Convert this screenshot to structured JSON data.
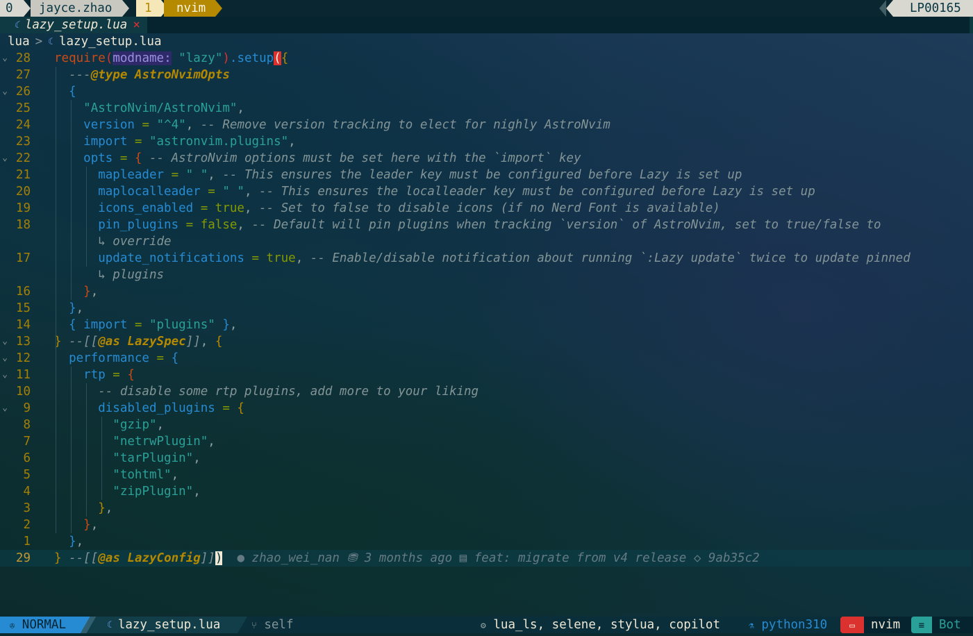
{
  "tmux": {
    "window_index": "0",
    "session": "jayce.zhao",
    "pane_index": "1",
    "program": "nvim",
    "host": "LP00165"
  },
  "tab": {
    "filename": "lazy_setup.lua",
    "close": "×"
  },
  "breadcrumb": {
    "dir": "lua",
    "separator": ">",
    "file": "lazy_setup.lua"
  },
  "lines": [
    {
      "num": "28",
      "fold": "v",
      "tokens": [
        [
          "kw",
          "require"
        ],
        [
          "br1",
          "("
        ],
        [
          "hint",
          "modname:"
        ],
        [
          "pun",
          " "
        ],
        [
          "str",
          "\"lazy\""
        ],
        [
          "br1",
          ")"
        ],
        [
          "fn",
          ".setup"
        ],
        [
          "match",
          "("
        ],
        [
          "br2",
          "{"
        ]
      ]
    },
    {
      "num": "27",
      "fold": "",
      "tokens": [
        [
          "cm",
          "  ---"
        ],
        [
          "an",
          "@type"
        ],
        [
          "pun",
          " "
        ],
        [
          "ty",
          "AstroNvimOpts"
        ]
      ]
    },
    {
      "num": "26",
      "fold": "v",
      "tokens": [
        [
          "pun",
          "  "
        ],
        [
          "br3",
          "{"
        ]
      ]
    },
    {
      "num": "25",
      "fold": "",
      "tokens": [
        [
          "pun",
          "    "
        ],
        [
          "str",
          "\"AstroNvim/AstroNvim\""
        ],
        [
          "pun",
          ","
        ]
      ]
    },
    {
      "num": "24",
      "fold": "",
      "tokens": [
        [
          "pun",
          "    "
        ],
        [
          "var",
          "version"
        ],
        [
          "op",
          " = "
        ],
        [
          "str",
          "\"^4\""
        ],
        [
          "pun",
          ", "
        ],
        [
          "cm",
          "-- Remove version tracking to elect for nighly AstroNvim"
        ]
      ]
    },
    {
      "num": "23",
      "fold": "",
      "tokens": [
        [
          "pun",
          "    "
        ],
        [
          "var",
          "import"
        ],
        [
          "op",
          " = "
        ],
        [
          "str",
          "\"astronvim.plugins\""
        ],
        [
          "pun",
          ","
        ]
      ]
    },
    {
      "num": "22",
      "fold": "v",
      "tokens": [
        [
          "pun",
          "    "
        ],
        [
          "var",
          "opts"
        ],
        [
          "op",
          " = "
        ],
        [
          "br5",
          "{"
        ],
        [
          "pun",
          " "
        ],
        [
          "cm",
          "-- AstroNvim options must be set here with the `import` key"
        ]
      ]
    },
    {
      "num": "21",
      "fold": "",
      "tokens": [
        [
          "pun",
          "      "
        ],
        [
          "var",
          "mapleader"
        ],
        [
          "op",
          " = "
        ],
        [
          "str",
          "\" \""
        ],
        [
          "pun",
          ", "
        ],
        [
          "cm",
          "-- This ensures the leader key must be configured before Lazy is set up"
        ]
      ]
    },
    {
      "num": "20",
      "fold": "",
      "tokens": [
        [
          "pun",
          "      "
        ],
        [
          "var",
          "maplocalleader"
        ],
        [
          "op",
          " = "
        ],
        [
          "str",
          "\" \""
        ],
        [
          "pun",
          ", "
        ],
        [
          "cm",
          "-- This ensures the localleader key must be configured before Lazy is set up"
        ]
      ]
    },
    {
      "num": "19",
      "fold": "",
      "tokens": [
        [
          "pun",
          "      "
        ],
        [
          "var",
          "icons_enabled"
        ],
        [
          "op",
          " = "
        ],
        [
          "bool",
          "true"
        ],
        [
          "pun",
          ", "
        ],
        [
          "cm",
          "-- Set to false to disable icons (if no Nerd Font is available)"
        ]
      ]
    },
    {
      "num": "18",
      "fold": "",
      "tokens": [
        [
          "pun",
          "      "
        ],
        [
          "var",
          "pin_plugins"
        ],
        [
          "op",
          " = "
        ],
        [
          "bool",
          "false"
        ],
        [
          "pun",
          ", "
        ],
        [
          "cm",
          "-- Default will pin plugins when tracking `version` of AstroNvim, set to true/false to"
        ]
      ]
    },
    {
      "num": "",
      "fold": "",
      "tokens": [
        [
          "pun",
          "      "
        ],
        [
          "wrapmark",
          "↳ "
        ],
        [
          "cm",
          "override"
        ]
      ]
    },
    {
      "num": "17",
      "fold": "",
      "tokens": [
        [
          "pun",
          "      "
        ],
        [
          "var",
          "update_notifications"
        ],
        [
          "op",
          " = "
        ],
        [
          "bool",
          "true"
        ],
        [
          "pun",
          ", "
        ],
        [
          "cm",
          "-- Enable/disable notification about running `:Lazy update` twice to update pinned"
        ]
      ]
    },
    {
      "num": "",
      "fold": "",
      "tokens": [
        [
          "pun",
          "      "
        ],
        [
          "wrapmark",
          "↳ "
        ],
        [
          "cm",
          "plugins"
        ]
      ]
    },
    {
      "num": "16",
      "fold": "",
      "tokens": [
        [
          "pun",
          "    "
        ],
        [
          "br5",
          "}"
        ],
        [
          "pun",
          ","
        ]
      ]
    },
    {
      "num": "15",
      "fold": "",
      "tokens": [
        [
          "pun",
          "  "
        ],
        [
          "br3",
          "}"
        ],
        [
          "pun",
          ","
        ]
      ]
    },
    {
      "num": "14",
      "fold": "",
      "tokens": [
        [
          "pun",
          "  "
        ],
        [
          "br3",
          "{"
        ],
        [
          "pun",
          " "
        ],
        [
          "var",
          "import"
        ],
        [
          "op",
          " = "
        ],
        [
          "str",
          "\"plugins\""
        ],
        [
          "pun",
          " "
        ],
        [
          "br3",
          "}"
        ],
        [
          "pun",
          ","
        ]
      ]
    },
    {
      "num": "13",
      "fold": "v",
      "tokens": [
        [
          "br2",
          "}"
        ],
        [
          "pun",
          " "
        ],
        [
          "cm",
          "--[["
        ],
        [
          "an",
          "@as"
        ],
        [
          "pun",
          " "
        ],
        [
          "ty",
          "LazySpec"
        ],
        [
          "cm",
          "]]"
        ],
        [
          "pun",
          ", "
        ],
        [
          "br2",
          "{"
        ]
      ]
    },
    {
      "num": "12",
      "fold": "v",
      "tokens": [
        [
          "pun",
          "  "
        ],
        [
          "var",
          "performance"
        ],
        [
          "op",
          " = "
        ],
        [
          "br3",
          "{"
        ]
      ]
    },
    {
      "num": "11",
      "fold": "v",
      "tokens": [
        [
          "pun",
          "    "
        ],
        [
          "var",
          "rtp"
        ],
        [
          "op",
          " = "
        ],
        [
          "br5",
          "{"
        ]
      ]
    },
    {
      "num": "10",
      "fold": "",
      "tokens": [
        [
          "pun",
          "      "
        ],
        [
          "cm",
          "-- disable some rtp plugins, add more to your liking"
        ]
      ]
    },
    {
      "num": "9",
      "fold": "v",
      "tokens": [
        [
          "pun",
          "      "
        ],
        [
          "var",
          "disabled_plugins"
        ],
        [
          "op",
          " = "
        ],
        [
          "br2",
          "{"
        ]
      ]
    },
    {
      "num": "8",
      "fold": "",
      "tokens": [
        [
          "pun",
          "        "
        ],
        [
          "str",
          "\"gzip\""
        ],
        [
          "pun",
          ","
        ]
      ]
    },
    {
      "num": "7",
      "fold": "",
      "tokens": [
        [
          "pun",
          "        "
        ],
        [
          "str",
          "\"netrwPlugin\""
        ],
        [
          "pun",
          ","
        ]
      ]
    },
    {
      "num": "6",
      "fold": "",
      "tokens": [
        [
          "pun",
          "        "
        ],
        [
          "str",
          "\"tarPlugin\""
        ],
        [
          "pun",
          ","
        ]
      ]
    },
    {
      "num": "5",
      "fold": "",
      "tokens": [
        [
          "pun",
          "        "
        ],
        [
          "str",
          "\"tohtml\""
        ],
        [
          "pun",
          ","
        ]
      ]
    },
    {
      "num": "4",
      "fold": "",
      "tokens": [
        [
          "pun",
          "        "
        ],
        [
          "str",
          "\"zipPlugin\""
        ],
        [
          "pun",
          ","
        ]
      ]
    },
    {
      "num": "3",
      "fold": "",
      "tokens": [
        [
          "pun",
          "      "
        ],
        [
          "br2",
          "}"
        ],
        [
          "pun",
          ","
        ]
      ]
    },
    {
      "num": "2",
      "fold": "",
      "tokens": [
        [
          "pun",
          "    "
        ],
        [
          "br5",
          "}"
        ],
        [
          "pun",
          ","
        ]
      ]
    },
    {
      "num": "1",
      "fold": "",
      "tokens": [
        [
          "pun",
          "  "
        ],
        [
          "br3",
          "}"
        ],
        [
          "pun",
          ","
        ]
      ]
    },
    {
      "num": "29",
      "fold": "",
      "current": true,
      "tokens": [
        [
          "br2",
          "}"
        ],
        [
          "pun",
          " "
        ],
        [
          "cm",
          "--[["
        ],
        [
          "an",
          "@as"
        ],
        [
          "pun",
          " "
        ],
        [
          "ty",
          "LazyConfig"
        ],
        [
          "cm",
          "]]"
        ],
        [
          "cursor",
          ")"
        ],
        [
          "pun",
          "  "
        ],
        [
          "blame",
          "● zhao_wei_nan ⛃ 3 months ago ▤ feat: migrate from v4 release ◇ 9ab35c2"
        ]
      ]
    }
  ],
  "status": {
    "mode": "NORMAL",
    "file": "lazy_setup.lua",
    "branch": "self",
    "lsp": "lua_ls, selene, stylua, copilot",
    "venv": "python310",
    "program": "nvim",
    "position": "Bot"
  },
  "colors": {
    "mode_bg": "#268bd2",
    "accent_orange": "#b58900",
    "error_red": "#dc322f",
    "green": "#2aa198"
  }
}
